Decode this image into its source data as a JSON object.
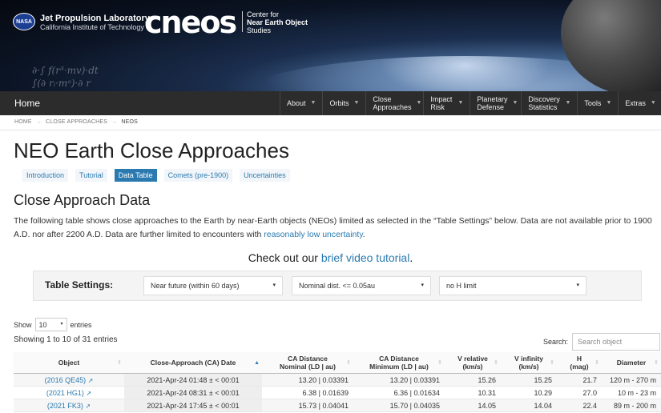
{
  "header": {
    "nasa_logo": "NASA",
    "jpl_title": "Jet Propulsion Laboratory",
    "jpl_subtitle": "California Institute of Technology",
    "cneos_logo": "cneos",
    "cneos_line1": "Center for",
    "cneos_line2": "Near Earth Object",
    "cneos_line3": "Studies"
  },
  "nav": {
    "home": "Home",
    "items": [
      "About",
      "Orbits",
      "Close Approaches",
      "Impact Risk",
      "Planetary Defense",
      "Discovery Statistics",
      "Tools",
      "Extras"
    ]
  },
  "breadcrumb": [
    "HOME",
    "CLOSE APPROACHES",
    "NEOS"
  ],
  "page_title": "NEO Earth Close Approaches",
  "tabs": [
    "Introduction",
    "Tutorial",
    "Data Table",
    "Comets (pre-1900)",
    "Uncertainties"
  ],
  "active_tab": "Data Table",
  "section_title": "Close Approach Data",
  "intro": {
    "text1": "The following table shows close approaches to the Earth by near-Earth objects (NEOs) limited as selected in the “Table Settings” below. Data are not available prior to 1900 A.D. nor after 2200 A.D. Data are further limited to encounters with ",
    "link": "reasonably low uncertainty",
    "text2": "."
  },
  "video": {
    "prefix": "Check out our ",
    "link": "brief video tutorial",
    "suffix": "."
  },
  "settings": {
    "label": "Table Settings:",
    "date_range": "Near future (within 60 days)",
    "distance": "Nominal dist. <= 0.05au",
    "h_limit": "no H limit"
  },
  "controls": {
    "show_label": "Show",
    "entries_value": "10",
    "entries_label": "entries",
    "info": "Showing 1 to 10 of 31 entries",
    "search_label": "Search:",
    "search_placeholder": "Search object"
  },
  "table": {
    "headers": {
      "object": "Object",
      "date": "Close-Approach (CA) Date",
      "nom_dist_1": "CA Distance",
      "nom_dist_2": "Nominal (LD | au)",
      "min_dist_1": "CA Distance",
      "min_dist_2": "Minimum (LD | au)",
      "vrel_1": "V relative",
      "vrel_2": "(km/s)",
      "vinf_1": "V infinity",
      "vinf_2": "(km/s)",
      "h_1": "H",
      "h_2": "(mag)",
      "diameter": "Diameter"
    },
    "rows": [
      {
        "object": "(2016 QE45)",
        "date": "2021-Apr-24 01:48 ± < 00:01",
        "nominal": "13.20 | 0.03391",
        "minimum": "13.20 | 0.03391",
        "vrel": "15.26",
        "vinf": "15.25",
        "h": "21.7",
        "diameter": "120 m - 270 m"
      },
      {
        "object": "(2021 HG1)",
        "date": "2021-Apr-24 08:31 ± < 00:01",
        "nominal": "6.38 | 0.01639",
        "minimum": "6.36 | 0.01634",
        "vrel": "10.31",
        "vinf": "10.29",
        "h": "27.0",
        "diameter": "10 m - 23 m"
      },
      {
        "object": "(2021 FK3)",
        "date": "2021-Apr-24 17:45 ± < 00:01",
        "nominal": "15.73 | 0.04041",
        "minimum": "15.70 | 0.04035",
        "vrel": "14.05",
        "vinf": "14.04",
        "h": "22.4",
        "diameter": "89 m - 200 m"
      }
    ]
  },
  "colors": {
    "link": "#2a7ab0",
    "nav_bg": "#2c2c2c",
    "active_tab": "#2a7ab0"
  }
}
